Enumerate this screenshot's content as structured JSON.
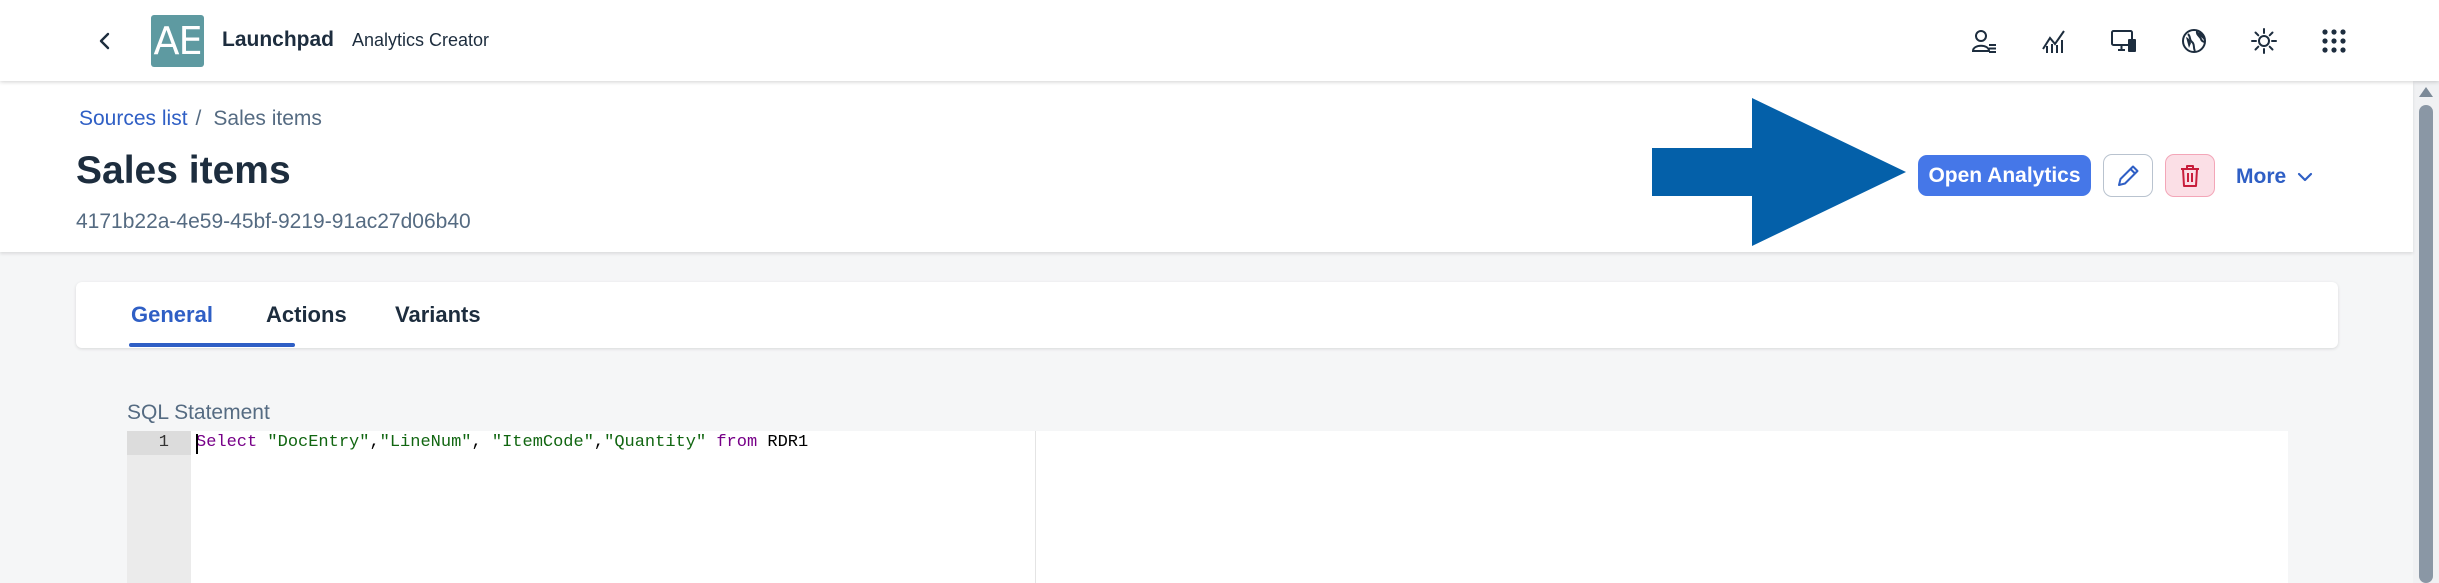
{
  "shell": {
    "logo_text": "AE",
    "brand": "Launchpad",
    "app_title": "Analytics Creator",
    "icons": [
      "user-settings-icon",
      "analytics-icon",
      "device-icon",
      "globe-icon",
      "theme-icon",
      "app-grid-icon"
    ]
  },
  "header": {
    "breadcrumb": {
      "link": "Sources list",
      "separator": "/",
      "current": "Sales items"
    },
    "title": "Sales items",
    "object_id": "4171b22a-4e59-45bf-9219-91ac27d06b40",
    "actions": {
      "open_analytics": "Open Analytics",
      "more": "More"
    }
  },
  "tabs": [
    {
      "label": "General",
      "active": true
    },
    {
      "label": "Actions",
      "active": false
    },
    {
      "label": "Variants",
      "active": false
    }
  ],
  "sql": {
    "label": "SQL Statement",
    "line_number": "1",
    "tokens": {
      "t1": "Select",
      "t2": " ",
      "t3": "\"DocEntry\"",
      "t4": ",",
      "t5": "\"LineNum\"",
      "t6": ", ",
      "t7": "\"ItemCode\"",
      "t8": ",",
      "t9": "\"Quantity\"",
      "t10": " ",
      "t11": "from",
      "t12": " RDR1"
    }
  },
  "colors": {
    "accent": "#2f5fc5",
    "button_emphasized": "#4577e8",
    "arrow": "#0460a9",
    "delete": "#c81e3c"
  }
}
